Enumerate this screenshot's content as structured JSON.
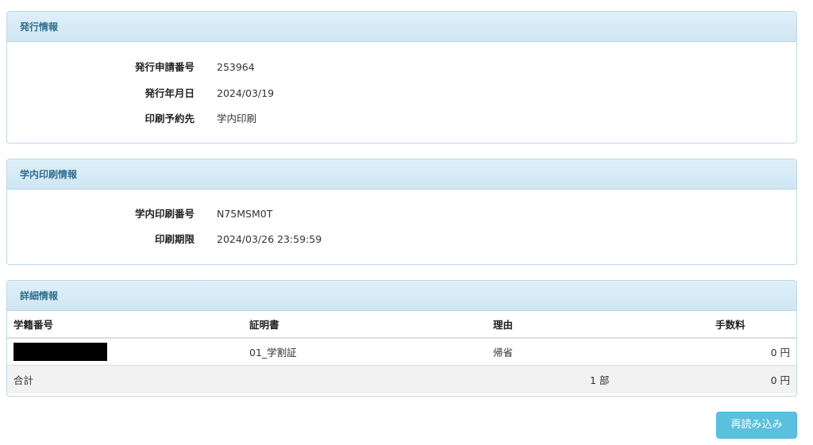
{
  "issue_info": {
    "heading": "発行情報",
    "rows": [
      {
        "label": "発行申請番号",
        "value": "253964"
      },
      {
        "label": "発行年月日",
        "value": "2024/03/19"
      },
      {
        "label": "印刷予約先",
        "value": "学内印刷"
      }
    ]
  },
  "print_info": {
    "heading": "学内印刷情報",
    "rows": [
      {
        "label": "学内印刷番号",
        "value": "N75MSM0T"
      },
      {
        "label": "印刷期限",
        "value": "2024/03/26 23:59:59"
      }
    ]
  },
  "detail_info": {
    "heading": "詳細情報",
    "columns": [
      "学籍番号",
      "証明書",
      "理由",
      "手数料"
    ],
    "rows": [
      {
        "student_id": "",
        "certificate": "01_学割証",
        "reason": "帰省",
        "fee": "0 円"
      }
    ],
    "total": {
      "label": "合計",
      "count": "1 部",
      "fee": "0 円"
    }
  },
  "actions": {
    "reload_label": "再読み込み"
  }
}
